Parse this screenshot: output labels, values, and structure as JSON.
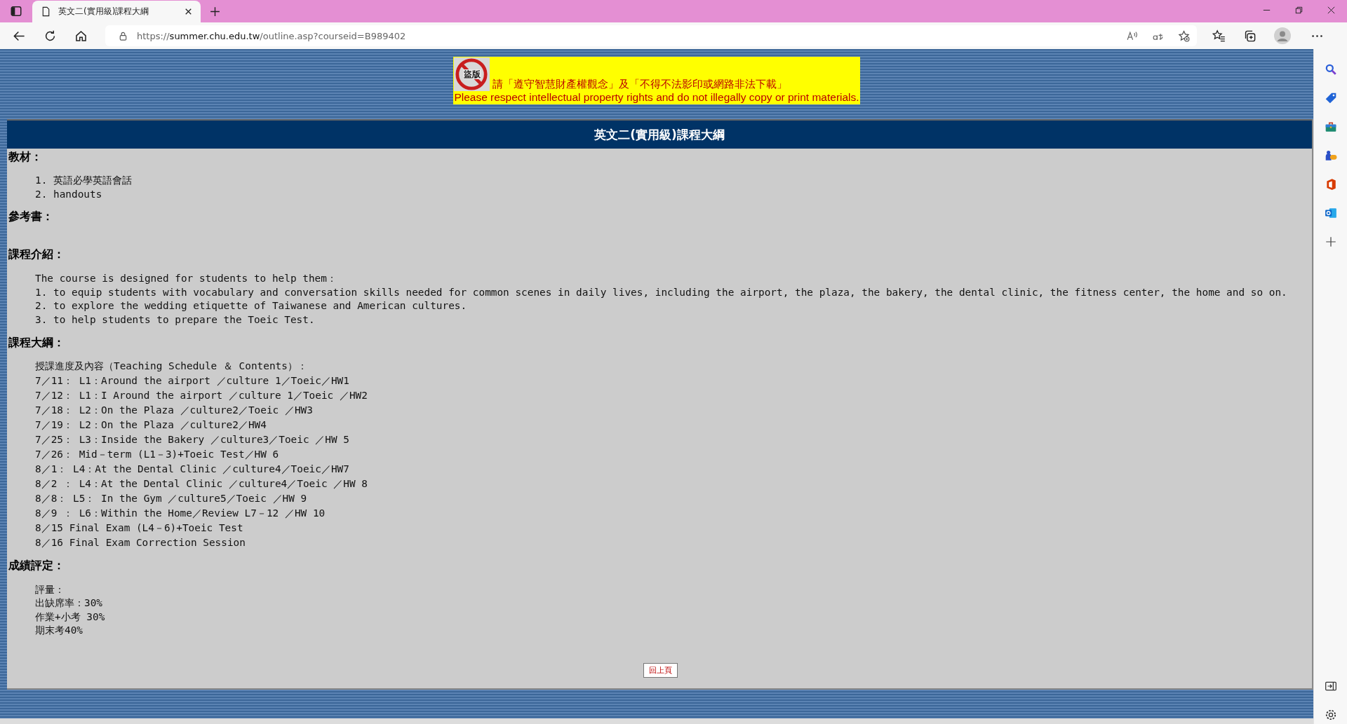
{
  "browser": {
    "tab_title": "英文二(實用級)課程大綱",
    "url_prefix": "https://",
    "url_host": "summer.chu.edu.tw",
    "url_path": "/outline.asp?courseid=B989402"
  },
  "notice": {
    "badge": "盜版",
    "chinese": "請「遵守智慧財產權觀念」及「不得不法影印或網路非法下載」",
    "english": "Please respect intellectual property rights and do not illegally copy or print materials."
  },
  "page_title": "英文二(實用級)課程大綱",
  "sections": [
    {
      "heading": "教材：",
      "lines": [
        "1. 英語必學英語會話",
        "2. handouts"
      ]
    },
    {
      "heading": "參考書："
    },
    {
      "heading": "課程介紹：",
      "lines": [
        "The course is designed for students to help them：",
        "1. to equip students with vocabulary and conversation skills needed for common scenes in daily lives, including the airport, the plaza, the bakery, the dental clinic, the fitness center, the home and so on.",
        "2. to explore the wedding etiquette of Taiwanese and American cultures.",
        "3. to help students to prepare the Toeic Test."
      ]
    },
    {
      "heading": "課程大綱：",
      "lines": [
        "授課進度及內容（Teaching Schedule ＆ Contents）：",
        "7／11： L1：Around the airport ／culture 1／Toeic／HW1",
        "7／12： L1：I Around the airport ／culture 1／Toeic ／HW2",
        "7／18： L2：On the Plaza ／culture2／Toeic ／HW3",
        "7／19： L2：On the Plaza ／culture2／HW4",
        "7／25： L3：Inside the Bakery ／culture3／Toeic ／HW 5",
        "7／26： Mid－term (L1－3)+Toeic Test／HW 6",
        "8／1： L4：At the Dental Clinic ／culture4／Toeic／HW7",
        "8／2 ： L4：At the Dental Clinic ／culture4／Toeic ／HW 8",
        "8／8： L5： In the Gym ／culture5／Toeic ／HW 9",
        "8／9 ： L6：Within the Home／Review L7－12 ／HW 10",
        "8／15 Final Exam (L4－6)+Toeic Test",
        "8／16 Final Exam Correction Session"
      ]
    },
    {
      "heading": "成績評定：",
      "lines": [
        "評量：",
        "出缺席率：30%",
        "作業+小考 30%",
        "期末考40%"
      ]
    }
  ],
  "back_button": "回上頁"
}
